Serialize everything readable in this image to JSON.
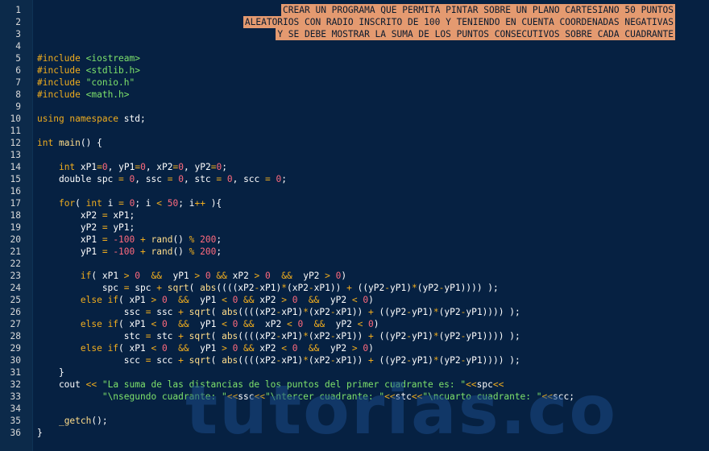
{
  "watermark": "tutorias.co",
  "banner": [
    "CREAR UN PROGRAMA QUE PERMITA PINTAR SOBRE UN PLANO CARTESIANO 50 PUNTOS",
    "ALEATORIOS CON RADIO INSCRITO DE 100 Y TENIENDO EN CUENTA COORDENADAS NEGATIVAS",
    "Y SE DEBE MOSTRAR LA SUMA DE LOS PUNTOS CONSECUTIVOS SOBRE CADA CUADRANTE"
  ],
  "colors": {
    "background": "#062142",
    "keyword": "#f0ad1e",
    "number": "#ff6a7d",
    "string": "#7ee26b",
    "banner": "#e49a70"
  },
  "lines": [
    {
      "n": "1",
      "banner": 0
    },
    {
      "n": "2",
      "banner": 1
    },
    {
      "n": "3",
      "banner": 2
    },
    {
      "n": "4",
      "tok": []
    },
    {
      "n": "5",
      "tok": [
        [
          "pre",
          "#include "
        ],
        [
          "inc",
          "<iostream>"
        ]
      ]
    },
    {
      "n": "6",
      "tok": [
        [
          "pre",
          "#include "
        ],
        [
          "inc",
          "<stdlib.h>"
        ]
      ]
    },
    {
      "n": "7",
      "tok": [
        [
          "pre",
          "#include "
        ],
        [
          "inc",
          "\"conio.h\""
        ]
      ]
    },
    {
      "n": "8",
      "tok": [
        [
          "pre",
          "#include "
        ],
        [
          "inc",
          "<math.h>"
        ]
      ]
    },
    {
      "n": "9",
      "tok": []
    },
    {
      "n": "10",
      "tok": [
        [
          "kw",
          "using namespace "
        ],
        [
          "id",
          "std;"
        ]
      ]
    },
    {
      "n": "11",
      "tok": []
    },
    {
      "n": "12",
      "tok": [
        [
          "kw",
          "int "
        ],
        [
          "fn",
          "main"
        ],
        [
          "id",
          "() {"
        ]
      ]
    },
    {
      "n": "13",
      "tok": []
    },
    {
      "n": "14",
      "tok": [
        [
          "id",
          "    "
        ],
        [
          "kw",
          "int "
        ],
        [
          "id",
          "xP1"
        ],
        [
          "op",
          "="
        ],
        [
          "num",
          "0"
        ],
        [
          "id",
          ", yP1"
        ],
        [
          "op",
          "="
        ],
        [
          "num",
          "0"
        ],
        [
          "id",
          ", xP2"
        ],
        [
          "op",
          "="
        ],
        [
          "num",
          "0"
        ],
        [
          "id",
          ", yP2"
        ],
        [
          "op",
          "="
        ],
        [
          "num",
          "0"
        ],
        [
          "id",
          ";"
        ]
      ]
    },
    {
      "n": "15",
      "tok": [
        [
          "id",
          "    double spc "
        ],
        [
          "op",
          "= "
        ],
        [
          "num",
          "0"
        ],
        [
          "id",
          ", ssc "
        ],
        [
          "op",
          "= "
        ],
        [
          "num",
          "0"
        ],
        [
          "id",
          ", stc "
        ],
        [
          "op",
          "= "
        ],
        [
          "num",
          "0"
        ],
        [
          "id",
          ", scc "
        ],
        [
          "op",
          "= "
        ],
        [
          "num",
          "0"
        ],
        [
          "id",
          ";"
        ]
      ]
    },
    {
      "n": "16",
      "tok": []
    },
    {
      "n": "17",
      "tok": [
        [
          "id",
          "    "
        ],
        [
          "kw",
          "for"
        ],
        [
          "id",
          "( "
        ],
        [
          "kw",
          "int "
        ],
        [
          "id",
          "i "
        ],
        [
          "op",
          "= "
        ],
        [
          "num",
          "0"
        ],
        [
          "id",
          "; i "
        ],
        [
          "op",
          "< "
        ],
        [
          "num",
          "50"
        ],
        [
          "id",
          "; i"
        ],
        [
          "op",
          "++"
        ],
        [
          "id",
          " ){"
        ]
      ]
    },
    {
      "n": "18",
      "tok": [
        [
          "id",
          "        xP2 "
        ],
        [
          "op",
          "= "
        ],
        [
          "id",
          "xP1;"
        ]
      ]
    },
    {
      "n": "19",
      "tok": [
        [
          "id",
          "        yP2 "
        ],
        [
          "op",
          "= "
        ],
        [
          "id",
          "yP1;"
        ]
      ]
    },
    {
      "n": "20",
      "tok": [
        [
          "id",
          "        xP1 "
        ],
        [
          "op",
          "= "
        ],
        [
          "num",
          "-100 "
        ],
        [
          "op",
          "+ "
        ],
        [
          "fn",
          "rand"
        ],
        [
          "id",
          "() "
        ],
        [
          "op",
          "% "
        ],
        [
          "num",
          "200"
        ],
        [
          "id",
          ";"
        ]
      ]
    },
    {
      "n": "21",
      "tok": [
        [
          "id",
          "        yP1 "
        ],
        [
          "op",
          "= "
        ],
        [
          "num",
          "-100 "
        ],
        [
          "op",
          "+ "
        ],
        [
          "fn",
          "rand"
        ],
        [
          "id",
          "() "
        ],
        [
          "op",
          "% "
        ],
        [
          "num",
          "200"
        ],
        [
          "id",
          ";"
        ]
      ]
    },
    {
      "n": "22",
      "tok": []
    },
    {
      "n": "23",
      "tok": [
        [
          "id",
          "        "
        ],
        [
          "kw",
          "if"
        ],
        [
          "id",
          "( xP1 "
        ],
        [
          "op",
          "> "
        ],
        [
          "num",
          "0  "
        ],
        [
          "op",
          "&&"
        ],
        [
          "id",
          "  yP1 "
        ],
        [
          "op",
          "> "
        ],
        [
          "num",
          "0 "
        ],
        [
          "op",
          "&&"
        ],
        [
          "id",
          " xP2 "
        ],
        [
          "op",
          "> "
        ],
        [
          "num",
          "0  "
        ],
        [
          "op",
          "&&"
        ],
        [
          "id",
          "  yP2 "
        ],
        [
          "op",
          "> "
        ],
        [
          "num",
          "0"
        ],
        [
          "id",
          ")"
        ]
      ]
    },
    {
      "n": "24",
      "tok": [
        [
          "id",
          "            spc "
        ],
        [
          "op",
          "= "
        ],
        [
          "id",
          "spc "
        ],
        [
          "op",
          "+ "
        ],
        [
          "fn",
          "sqrt"
        ],
        [
          "id",
          "( "
        ],
        [
          "fn",
          "abs"
        ],
        [
          "id",
          "((((xP2"
        ],
        [
          "op",
          "-"
        ],
        [
          "id",
          "xP1)"
        ],
        [
          "op",
          "*"
        ],
        [
          "id",
          "(xP2"
        ],
        [
          "op",
          "-"
        ],
        [
          "id",
          "xP1)) "
        ],
        [
          "op",
          "+ "
        ],
        [
          "id",
          "((yP2"
        ],
        [
          "op",
          "-"
        ],
        [
          "id",
          "yP1)"
        ],
        [
          "op",
          "*"
        ],
        [
          "id",
          "(yP2"
        ],
        [
          "op",
          "-"
        ],
        [
          "id",
          "yP1)))) );"
        ]
      ]
    },
    {
      "n": "25",
      "tok": [
        [
          "id",
          "        "
        ],
        [
          "kw",
          "else if"
        ],
        [
          "id",
          "( xP1 "
        ],
        [
          "op",
          "> "
        ],
        [
          "num",
          "0  "
        ],
        [
          "op",
          "&&"
        ],
        [
          "id",
          "  yP1 "
        ],
        [
          "op",
          "< "
        ],
        [
          "num",
          "0 "
        ],
        [
          "op",
          "&&"
        ],
        [
          "id",
          " xP2 "
        ],
        [
          "op",
          "> "
        ],
        [
          "num",
          "0  "
        ],
        [
          "op",
          "&&"
        ],
        [
          "id",
          "  yP2 "
        ],
        [
          "op",
          "< "
        ],
        [
          "num",
          "0"
        ],
        [
          "id",
          ")"
        ]
      ]
    },
    {
      "n": "26",
      "tok": [
        [
          "id",
          "                ssc "
        ],
        [
          "op",
          "= "
        ],
        [
          "id",
          "ssc "
        ],
        [
          "op",
          "+ "
        ],
        [
          "fn",
          "sqrt"
        ],
        [
          "id",
          "( "
        ],
        [
          "fn",
          "abs"
        ],
        [
          "id",
          "((((xP2"
        ],
        [
          "op",
          "-"
        ],
        [
          "id",
          "xP1)"
        ],
        [
          "op",
          "*"
        ],
        [
          "id",
          "(xP2"
        ],
        [
          "op",
          "-"
        ],
        [
          "id",
          "xP1)) "
        ],
        [
          "op",
          "+ "
        ],
        [
          "id",
          "((yP2"
        ],
        [
          "op",
          "-"
        ],
        [
          "id",
          "yP1)"
        ],
        [
          "op",
          "*"
        ],
        [
          "id",
          "(yP2"
        ],
        [
          "op",
          "-"
        ],
        [
          "id",
          "yP1)))) );"
        ]
      ]
    },
    {
      "n": "27",
      "tok": [
        [
          "id",
          "        "
        ],
        [
          "kw",
          "else if"
        ],
        [
          "id",
          "( xP1 "
        ],
        [
          "op",
          "< "
        ],
        [
          "num",
          "0  "
        ],
        [
          "op",
          "&&"
        ],
        [
          "id",
          "  yP1 "
        ],
        [
          "op",
          "< "
        ],
        [
          "num",
          "0 "
        ],
        [
          "op",
          "&&"
        ],
        [
          "id",
          "  xP2 "
        ],
        [
          "op",
          "< "
        ],
        [
          "num",
          "0  "
        ],
        [
          "op",
          "&&"
        ],
        [
          "id",
          "  yP2 "
        ],
        [
          "op",
          "< "
        ],
        [
          "num",
          "0"
        ],
        [
          "id",
          ")"
        ]
      ]
    },
    {
      "n": "28",
      "tok": [
        [
          "id",
          "                stc "
        ],
        [
          "op",
          "= "
        ],
        [
          "id",
          "stc "
        ],
        [
          "op",
          "+ "
        ],
        [
          "fn",
          "sqrt"
        ],
        [
          "id",
          "( "
        ],
        [
          "fn",
          "abs"
        ],
        [
          "id",
          "((((xP2"
        ],
        [
          "op",
          "-"
        ],
        [
          "id",
          "xP1)"
        ],
        [
          "op",
          "*"
        ],
        [
          "id",
          "(xP2"
        ],
        [
          "op",
          "-"
        ],
        [
          "id",
          "xP1)) "
        ],
        [
          "op",
          "+ "
        ],
        [
          "id",
          "((yP2"
        ],
        [
          "op",
          "-"
        ],
        [
          "id",
          "yP1)"
        ],
        [
          "op",
          "*"
        ],
        [
          "id",
          "(yP2"
        ],
        [
          "op",
          "-"
        ],
        [
          "id",
          "yP1)))) );"
        ]
      ]
    },
    {
      "n": "29",
      "tok": [
        [
          "id",
          "        "
        ],
        [
          "kw",
          "else if"
        ],
        [
          "id",
          "( xP1 "
        ],
        [
          "op",
          "< "
        ],
        [
          "num",
          "0  "
        ],
        [
          "op",
          "&&"
        ],
        [
          "id",
          "  yP1 "
        ],
        [
          "op",
          "> "
        ],
        [
          "num",
          "0 "
        ],
        [
          "op",
          "&&"
        ],
        [
          "id",
          " xP2 "
        ],
        [
          "op",
          "< "
        ],
        [
          "num",
          "0  "
        ],
        [
          "op",
          "&&"
        ],
        [
          "id",
          "  yP2 "
        ],
        [
          "op",
          "> "
        ],
        [
          "num",
          "0"
        ],
        [
          "id",
          ")"
        ]
      ]
    },
    {
      "n": "30",
      "tok": [
        [
          "id",
          "                scc "
        ],
        [
          "op",
          "= "
        ],
        [
          "id",
          "scc "
        ],
        [
          "op",
          "+ "
        ],
        [
          "fn",
          "sqrt"
        ],
        [
          "id",
          "( "
        ],
        [
          "fn",
          "abs"
        ],
        [
          "id",
          "((((xP2"
        ],
        [
          "op",
          "-"
        ],
        [
          "id",
          "xP1)"
        ],
        [
          "op",
          "*"
        ],
        [
          "id",
          "(xP2"
        ],
        [
          "op",
          "-"
        ],
        [
          "id",
          "xP1)) "
        ],
        [
          "op",
          "+ "
        ],
        [
          "id",
          "((yP2"
        ],
        [
          "op",
          "-"
        ],
        [
          "id",
          "yP1)"
        ],
        [
          "op",
          "*"
        ],
        [
          "id",
          "(yP2"
        ],
        [
          "op",
          "-"
        ],
        [
          "id",
          "yP1)))) );"
        ]
      ]
    },
    {
      "n": "31",
      "tok": [
        [
          "id",
          "    }"
        ]
      ]
    },
    {
      "n": "32",
      "tok": [
        [
          "id",
          "    cout "
        ],
        [
          "op",
          "<< "
        ],
        [
          "str",
          "\"La suma de las distancias de los puntos del primer cuadrante es: \""
        ],
        [
          "op",
          "<<"
        ],
        [
          "id",
          "spc"
        ],
        [
          "op",
          "<<"
        ]
      ]
    },
    {
      "n": "33",
      "tok": [
        [
          "id",
          "            "
        ],
        [
          "str",
          "\"\\nsegundo cuadrante: \""
        ],
        [
          "op",
          "<<"
        ],
        [
          "id",
          "ssc"
        ],
        [
          "op",
          "<<"
        ],
        [
          "str",
          "\"\\ntercer cuadrante: \""
        ],
        [
          "op",
          "<<"
        ],
        [
          "id",
          "stc"
        ],
        [
          "op",
          "<<"
        ],
        [
          "str",
          "\"\\ncuarto cuadrante: \""
        ],
        [
          "op",
          "<<"
        ],
        [
          "id",
          "scc;"
        ]
      ]
    },
    {
      "n": "34",
      "tok": []
    },
    {
      "n": "35",
      "tok": [
        [
          "id",
          "    "
        ],
        [
          "fn",
          "_getch"
        ],
        [
          "id",
          "();"
        ]
      ]
    },
    {
      "n": "36",
      "tok": [
        [
          "id",
          "}"
        ]
      ]
    }
  ]
}
